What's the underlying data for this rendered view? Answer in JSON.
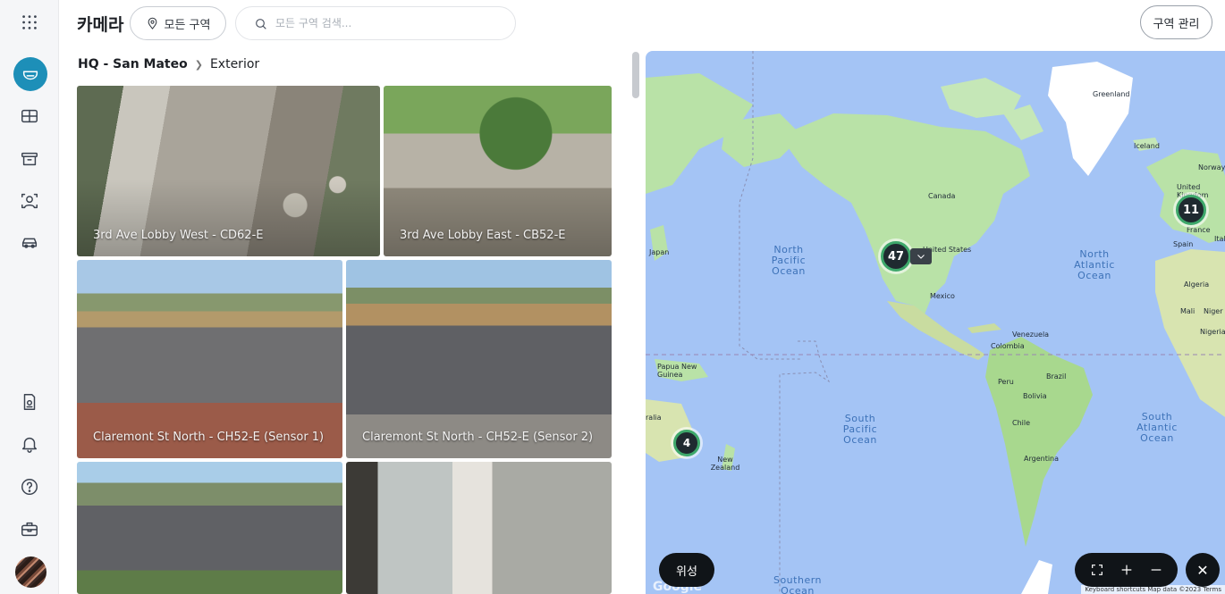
{
  "header": {
    "title": "카메라",
    "zone_button": "모든 구역",
    "search_placeholder": "모든 구역 검색...",
    "manage_button": "구역 관리"
  },
  "breadcrumb": {
    "root": "HQ - San Mateo",
    "current": "Exterior"
  },
  "cameras": [
    {
      "label": "3rd Ave Lobby West - CD62-E"
    },
    {
      "label": "3rd Ave Lobby East - CB52-E"
    },
    {
      "label": "Claremont St North - CH52-E (Sensor 1)"
    },
    {
      "label": "Claremont St North - CH52-E (Sensor 2)"
    },
    {
      "label": ""
    },
    {
      "label": ""
    }
  ],
  "map": {
    "clusters": [
      "47",
      "11",
      "4"
    ],
    "country_labels": {
      "greenland": "Greenland",
      "iceland": "Iceland",
      "norway": "Norway",
      "uk": "United Kingdom",
      "france": "France",
      "spain": "Spain",
      "italy": "Ital",
      "canada": "Canada",
      "us": "United States",
      "mexico": "Mexico",
      "japan": "Japan",
      "venezuela": "Venezuela",
      "colombia": "Colombia",
      "peru": "Peru",
      "brazil": "Brazil",
      "bolivia": "Bolivia",
      "chile": "Chile",
      "argentina": "Argentina",
      "algeria": "Algeria",
      "mali": "Mali",
      "niger": "Niger",
      "nigeria": "Nigeria",
      "png": "Papua New Guinea",
      "australia": "ralia",
      "nz": "New Zealand"
    },
    "ocean_labels": {
      "north_pacific": "North Pacific Ocean",
      "north_atlantic": "North Atlantic Ocean",
      "south_pacific": "South Pacific Ocean",
      "south_atlantic": "South Atlantic Ocean",
      "southern": "Southern Ocean"
    },
    "satellite_button": "위성",
    "logo": "Google",
    "attribution": "Keyboard shortcuts   Map data ©2023   Terms"
  },
  "icons": {
    "app_grid": "app-grid-icon",
    "cameras": "camera-dome-icon",
    "layout": "layout-grid-icon",
    "archive": "archive-icon",
    "people": "person-scan-icon",
    "vehicle": "vehicle-icon",
    "badge": "badge-icon",
    "alerts": "bell-icon",
    "help": "help-icon",
    "toolbox": "toolbox-icon"
  },
  "colors": {
    "accent": "#1d8fb8",
    "cluster_ring": "#3ea86b",
    "map_water": "#a4c4f5",
    "land": "#bde4b0"
  }
}
